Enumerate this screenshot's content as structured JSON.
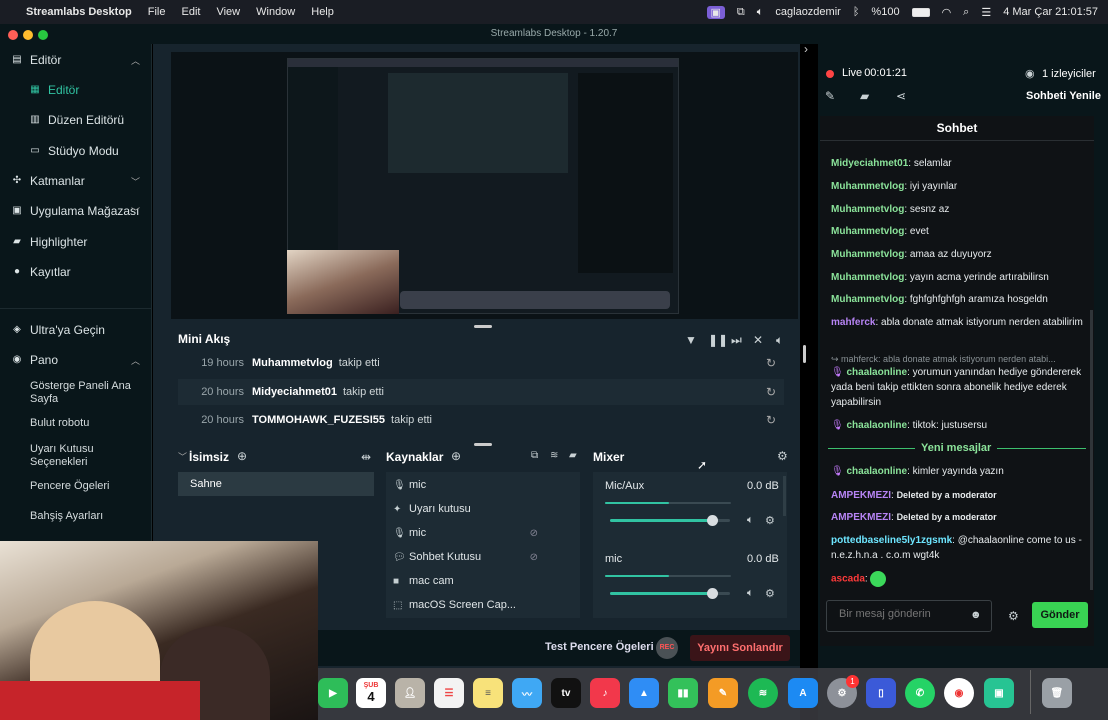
{
  "menubar": {
    "app_name": "Streamlabs Desktop",
    "menus": [
      "File",
      "Edit",
      "View",
      "Window",
      "Help"
    ],
    "user": "caglaozdemir",
    "battery": "%100",
    "datetime": "4 Mar Çar  21:01:57"
  },
  "window": {
    "title": "Streamlabs Desktop - 1.20.7"
  },
  "sidebar": {
    "editor_section": "Editör",
    "editor_item": "Editör",
    "layout_editor": "Düzen Editörü",
    "studio_mode": "Stüdyo Modu",
    "layers": "Katmanlar",
    "app_store": "Uygulama Mağazası",
    "highlighter": "Highlighter",
    "recordings": "Kayıtlar",
    "ultra": "Ultra'ya Geçin",
    "dashboard": "Pano",
    "dashboard_items": [
      "Gösterge Paneli Ana Sayfa",
      "Bulut robotu",
      "Uyarı Kutusu Seçenekleri",
      "Pencere Ögeleri",
      "Bahşiş Ayarları"
    ]
  },
  "mini_feed": {
    "title": "Mini Akış",
    "rows": [
      {
        "time": "19 hours",
        "user": "Muhammetvlog",
        "action": "takip etti"
      },
      {
        "time": "20 hours",
        "user": "Midyeciahmet01",
        "action": "takip etti"
      },
      {
        "time": "20 hours",
        "user": "TOMMOHAWK_FUZESI55",
        "action": "takip etti"
      }
    ]
  },
  "scenes": {
    "title": "İsimsiz",
    "items": [
      "Sahne"
    ]
  },
  "sources": {
    "title": "Kaynaklar",
    "items": [
      "mic",
      "Uyarı kutusu",
      "mic",
      "Sohbet Kutusu",
      "mac cam",
      "macOS Screen Cap..."
    ]
  },
  "mixer": {
    "title": "Mixer",
    "channels": [
      {
        "name": "Mic/Aux",
        "db": "0.0 dB",
        "level": 0.85
      },
      {
        "name": "mic",
        "db": "0.0 dB",
        "level": 0.85
      }
    ]
  },
  "bottom_bar": {
    "test_widgets": "Test Pencere Ögeleri",
    "end_stream": "Yayını Sonlandır",
    "rec": "REC"
  },
  "live": {
    "status": "Live",
    "time": "00:01:21",
    "viewers": "1 izleyiciler",
    "refresh_chat": "Sohbeti Yenile"
  },
  "chat": {
    "title": "Sohbet",
    "messages": [
      {
        "user": "Midyeciahmet01",
        "text": "selamlar",
        "color": "green"
      },
      {
        "user": "Muhammetvlog",
        "text": "iyi yayınlar",
        "color": "green"
      },
      {
        "user": "Muhammetvlog",
        "text": "sesnz az",
        "color": "green"
      },
      {
        "user": "Muhammetvlog",
        "text": "evet",
        "color": "green"
      },
      {
        "user": "Muhammetvlog",
        "text": "amaa az duyuyorz",
        "color": "green"
      },
      {
        "user": "Muhammetvlog",
        "text": "yayın acma yerinde artırabilirsn",
        "color": "green"
      },
      {
        "user": "Muhammetvlog",
        "text": "fghfghfghfgh aramıza hosgeldn",
        "color": "green"
      },
      {
        "user": "mahferck",
        "text": "abla donate atmak istiyorum nerden atabilirim",
        "color": "purple"
      },
      {
        "reply": "mahferck: abla donate atmak istiyorum nerden atabi..."
      },
      {
        "user": "chaalaonline",
        "text": "yorumun yanından hediye göndererek yada beni takip ettikten sonra abonelik hediye ederek yapabilirsin",
        "color": "green"
      },
      {
        "user": "chaalaonline",
        "text": "tiktok: justusersu",
        "color": "green"
      },
      {
        "user": "chaalaonline",
        "text": "kimler yayında yazın",
        "color": "green"
      },
      {
        "user": "AMPEKMEZI",
        "text": "Deleted by a moderator",
        "color": "purple"
      },
      {
        "user": "AMPEKMEZI",
        "text": "Deleted by a moderator",
        "color": "purple"
      },
      {
        "user": "pottedbaseline5ly1zgsmk",
        "text": "@chaalaonline come to us - n.e.z.h.n.a . c.o.m wgt4k",
        "color": "cyan"
      },
      {
        "user": "ascada",
        "text": "",
        "color": "red"
      }
    ],
    "new_messages_divider": "Yeni mesajlar",
    "input_placeholder": "Bir mesaj gönderin",
    "send_label": "Gönder"
  },
  "dock": {
    "calendar_month": "ŞUB",
    "calendar_day": "4",
    "badge": "1"
  }
}
